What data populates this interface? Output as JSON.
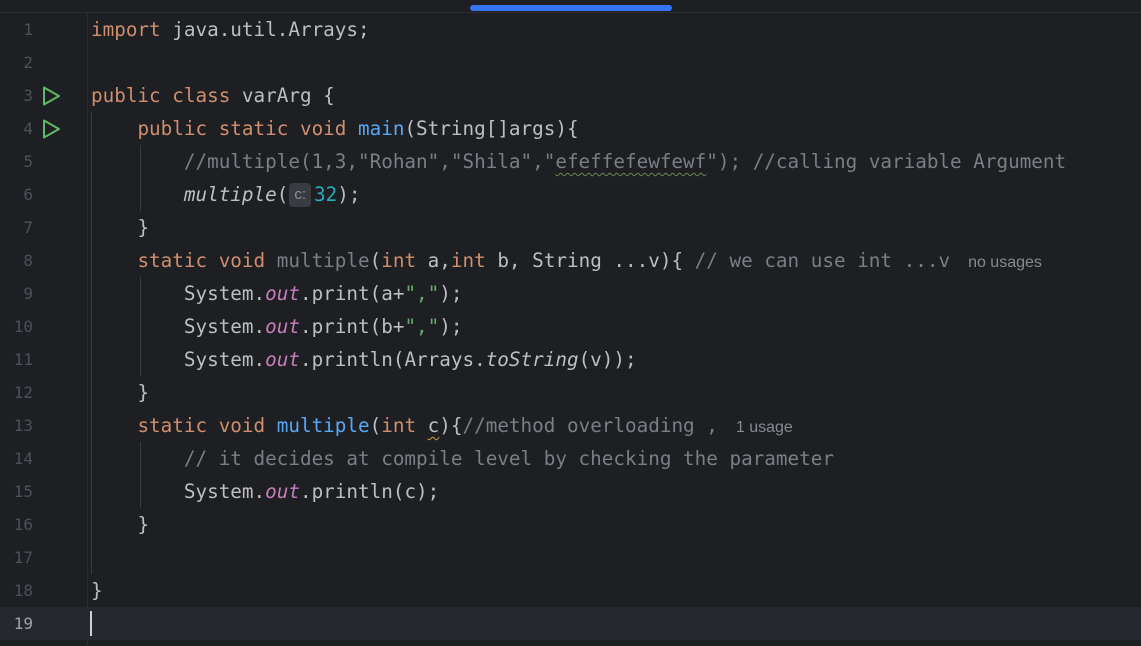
{
  "colors": {
    "background": "#1e1f22",
    "keyword": "#cf8e6d",
    "function": "#56a8f5",
    "string": "#6aab73",
    "number": "#2aacb8",
    "comment": "#7a7e85",
    "static_field": "#c77dbb",
    "scroll_thumb": "#3574f0",
    "run_icon": "#5fb865"
  },
  "editor": {
    "current_line": 19,
    "lines": [
      {
        "n": "1"
      },
      {
        "n": "2"
      },
      {
        "n": "3"
      },
      {
        "n": "4"
      },
      {
        "n": "5"
      },
      {
        "n": "6"
      },
      {
        "n": "7"
      },
      {
        "n": "8"
      },
      {
        "n": "9"
      },
      {
        "n": "10"
      },
      {
        "n": "11"
      },
      {
        "n": "12"
      },
      {
        "n": "13"
      },
      {
        "n": "14"
      },
      {
        "n": "15"
      },
      {
        "n": "16"
      },
      {
        "n": "17"
      },
      {
        "n": "18"
      },
      {
        "n": "19"
      }
    ],
    "l1": {
      "kw": "import",
      "rest": " java.util.Arrays;"
    },
    "l3": {
      "kw1": "public",
      "kw2": "class",
      "rest": " varArg {"
    },
    "l4": {
      "kw1": "public",
      "kw2": "static",
      "kw3": "void",
      "fn": "main",
      "rest": "(String[]args){"
    },
    "l5": {
      "c1": "//multiple(1,3,\"Rohan\",\"Shila\",\"",
      "typo": "efeffefewfewf",
      "c2": "\"); //calling variable Argument"
    },
    "l6": {
      "call": "multiple",
      "open": "(",
      "hint": "c:",
      "num": "32",
      "close": ");"
    },
    "l7": {
      "text": "}"
    },
    "l8": {
      "kw1": "static",
      "kw2": "void",
      "fn": "multiple",
      "p1": "(",
      "kw3": "int",
      "p2": " a,",
      "kw4": "int",
      "p3": " b, String ...v){ ",
      "cm": "// we can use int ...v",
      "usage": "no usages"
    },
    "l9": {
      "a": "System.",
      "field": "out",
      "b": ".print(a+",
      "str": "\",\"",
      "c": ");"
    },
    "l10": {
      "a": "System.",
      "field": "out",
      "b": ".print(b+",
      "str": "\",\"",
      "c": ");"
    },
    "l11": {
      "a": "System.",
      "field": "out",
      "b": ".println(Arrays.",
      "m": "toString",
      "c": "(v));"
    },
    "l12": {
      "text": "}"
    },
    "l13": {
      "kw1": "static",
      "kw2": "void",
      "fn": "multiple",
      "p1": "(",
      "kw3": "int",
      "p2": " ",
      "warn": "c",
      "p3": "){",
      "cm": "//method overloading ,",
      "usage": "1 usage"
    },
    "l14": {
      "cm": "// it decides at compile level by checking the parameter"
    },
    "l15": {
      "a": "System.",
      "field": "out",
      "b": ".println(c);"
    },
    "l16": {
      "text": "}"
    },
    "l18": {
      "text": "}"
    }
  }
}
